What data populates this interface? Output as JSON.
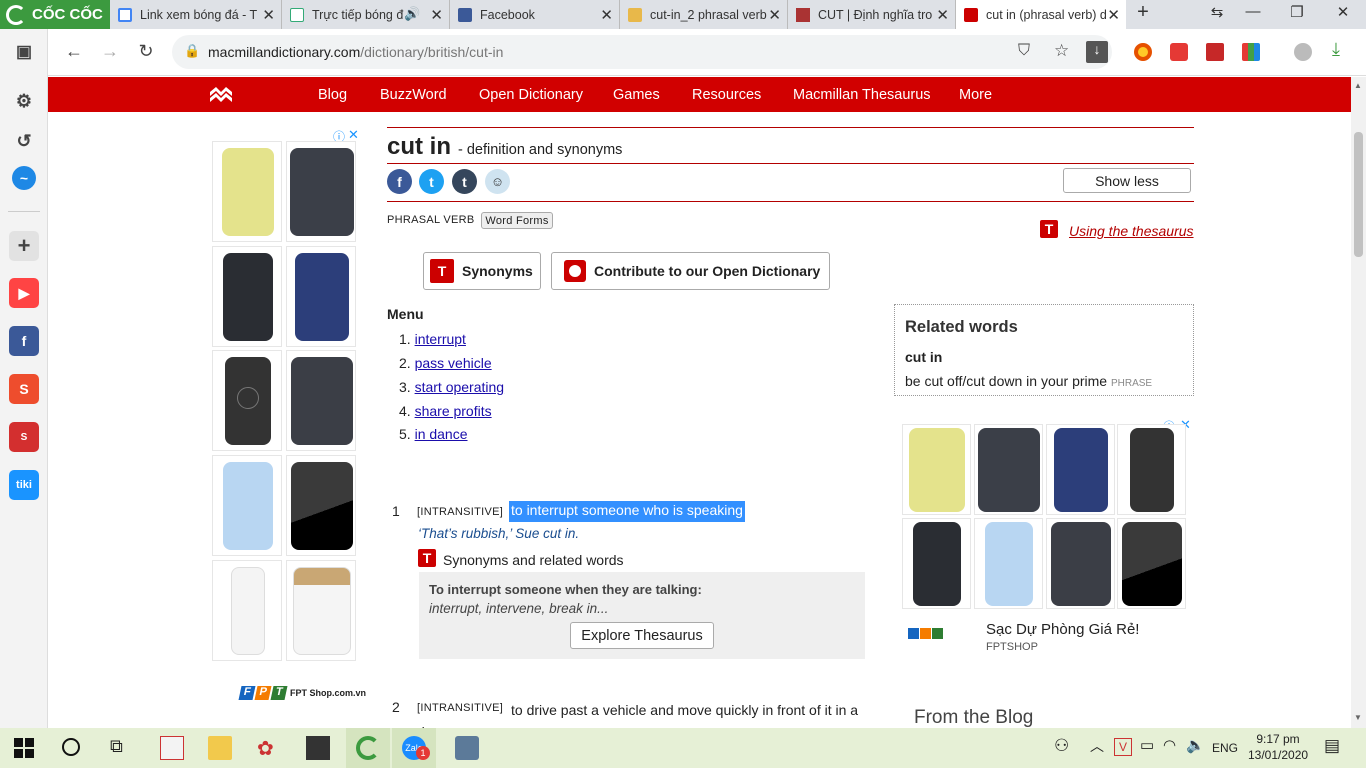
{
  "browser": {
    "brand": "CỐC CỐC",
    "tabs": [
      {
        "title": "Link xem bóng đá - T",
        "icon": "google-icon"
      },
      {
        "title": "Trực tiếp bóng đ",
        "icon": "page-icon"
      },
      {
        "title": "Facebook",
        "icon": "facebook-icon"
      },
      {
        "title": "cut-in_2 phrasal verb",
        "icon": "dictionary-icon"
      },
      {
        "title": "CUT | Định nghĩa tro",
        "icon": "cambridge-icon"
      },
      {
        "title": "cut in (phrasal verb) d",
        "icon": "macmillan-icon"
      }
    ],
    "url_domain": "macmillandictionary.com",
    "url_path": "/dictionary/british/cut-in"
  },
  "site_nav": {
    "items": [
      "Blog",
      "BuzzWord",
      "Open Dictionary",
      "Games",
      "Resources",
      "Macmillan Thesaurus",
      "More"
    ]
  },
  "entry": {
    "headword": "cut in",
    "subtitle": "- definition and synonyms",
    "show_less": "Show less",
    "pos": "PHRASAL VERB",
    "word_forms": "Word Forms",
    "using_thesaurus": "Using the thesaurus",
    "synonyms_btn": "Synonyms",
    "contribute_btn": "Contribute to our Open Dictionary",
    "menu_title": "Menu",
    "menu": [
      {
        "num": "1.",
        "label": "interrupt"
      },
      {
        "num": "2.",
        "label": "pass vehicle"
      },
      {
        "num": "3.",
        "label": "start operating"
      },
      {
        "num": "4.",
        "label": "share profits"
      },
      {
        "num": "5.",
        "label": "in dance"
      }
    ],
    "senses": [
      {
        "num": "1",
        "tag": "[INTRANSITIVE]",
        "definition": "to interrupt someone who is speaking",
        "example": "‘That’s rubbish,’ Sue cut in."
      },
      {
        "num": "2",
        "tag": "[INTRANSITIVE]",
        "definition": "to drive past a vehicle and move quickly in front of it in a dangerous way"
      }
    ],
    "syn_heading": "Synonyms and related words",
    "thes_title": "To interrupt someone when they are talking:",
    "thes_words": "interrupt, intervene, break in...",
    "explore": "Explore Thesaurus"
  },
  "related": {
    "title": "Related words",
    "word": "cut in",
    "phrase": "be cut off/cut down in your prime",
    "phrase_tag": "PHRASE"
  },
  "ad_right": {
    "title": "Sạc Dự Phòng Giá Rẻ!",
    "source": "FPTSHOP"
  },
  "ad_left": {
    "brand": "FPT Shop.com.vn"
  },
  "from_blog": "From the Blog",
  "taskbar": {
    "lang": "ENG",
    "time": "9:17 pm",
    "date": "13/01/2020",
    "zalo_badge": "1"
  },
  "colors": {
    "brand_red": "#d10000",
    "highlight": "#3390ff",
    "tab_bg": "#dee1e6"
  }
}
